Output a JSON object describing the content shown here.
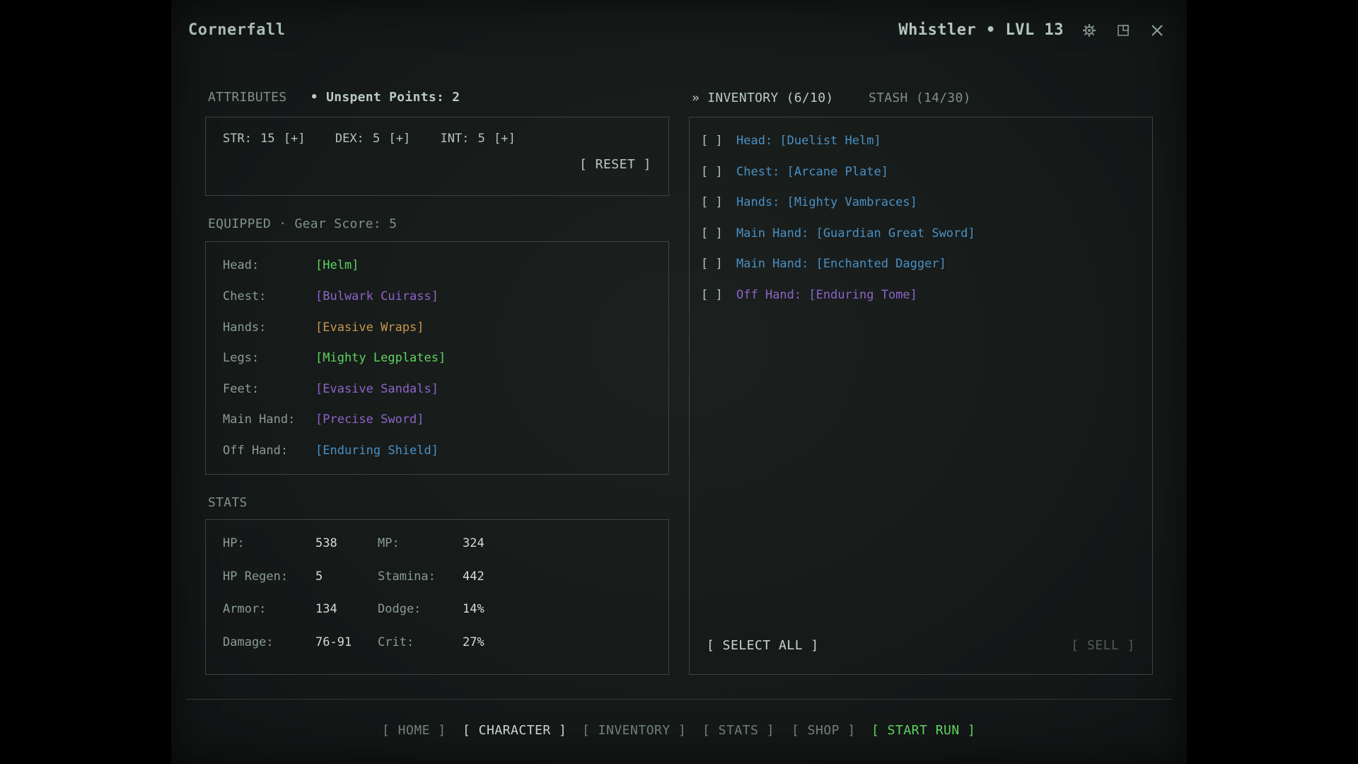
{
  "app": {
    "title": "Cornerfall",
    "player_label": "Whistler • LVL 13",
    "icons": {
      "settings": "gear-icon",
      "window": "window-icon",
      "close": "close-icon"
    }
  },
  "colors": {
    "green": "#5fd45f",
    "purple": "#8e64c9",
    "orange": "#c99650",
    "blue": "#4a90c4"
  },
  "attributes": {
    "heading": "ATTRIBUTES",
    "unspent": "• Unspent Points: 2",
    "str": "STR: 15 [+]",
    "dex": "DEX: 5 [+]",
    "int": "INT: 5 [+]",
    "reset": "[ RESET ]"
  },
  "equipped": {
    "heading": "EQUIPPED · Gear Score: 5",
    "slots": [
      {
        "slot": "Head:",
        "item": "[Helm]",
        "quality": "green"
      },
      {
        "slot": "Chest:",
        "item": "[Bulwark Cuirass]",
        "quality": "purple"
      },
      {
        "slot": "Hands:",
        "item": "[Evasive Wraps]",
        "quality": "orange"
      },
      {
        "slot": "Legs:",
        "item": "[Mighty Legplates]",
        "quality": "green"
      },
      {
        "slot": "Feet:",
        "item": "[Evasive Sandals]",
        "quality": "purple"
      },
      {
        "slot": "Main Hand:",
        "item": "[Precise Sword]",
        "quality": "purple"
      },
      {
        "slot": "Off Hand:",
        "item": "[Enduring Shield]",
        "quality": "blue"
      }
    ]
  },
  "stats": {
    "heading": "STATS",
    "rows": [
      {
        "l1": "HP:",
        "v1": "538",
        "l2": "MP:",
        "v2": "324"
      },
      {
        "l1": "HP Regen:",
        "v1": "5",
        "l2": "Stamina:",
        "v2": "442"
      },
      {
        "l1": "Armor:",
        "v1": "134",
        "l2": "Dodge:",
        "v2": "14%"
      },
      {
        "l1": "Damage:",
        "v1": "76-91",
        "l2": "Crit:",
        "v2": "27%"
      }
    ]
  },
  "inventory": {
    "tab_inventory": "» INVENTORY (6/10)",
    "tab_stash": "STASH (14/30)",
    "items": [
      {
        "check": "[ ]",
        "text": "Head: [Duelist Helm]",
        "quality": "blue"
      },
      {
        "check": "[ ]",
        "text": "Chest: [Arcane Plate]",
        "quality": "blue"
      },
      {
        "check": "[ ]",
        "text": "Hands: [Mighty Vambraces]",
        "quality": "blue"
      },
      {
        "check": "[ ]",
        "text": "Main Hand: [Guardian Great Sword]",
        "quality": "blue"
      },
      {
        "check": "[ ]",
        "text": "Main Hand: [Enchanted Dagger]",
        "quality": "blue"
      },
      {
        "check": "[ ]",
        "text": "Off Hand: [Enduring Tome]",
        "quality": "purple"
      }
    ],
    "select_all": "[ SELECT ALL ]",
    "sell": "[ SELL ]"
  },
  "nav": {
    "home": "[ HOME ]",
    "character": "[ CHARACTER ]",
    "inventory": "[ INVENTORY ]",
    "stats": "[ STATS ]",
    "shop": "[ SHOP ]",
    "start_run": "[ START RUN ]"
  }
}
